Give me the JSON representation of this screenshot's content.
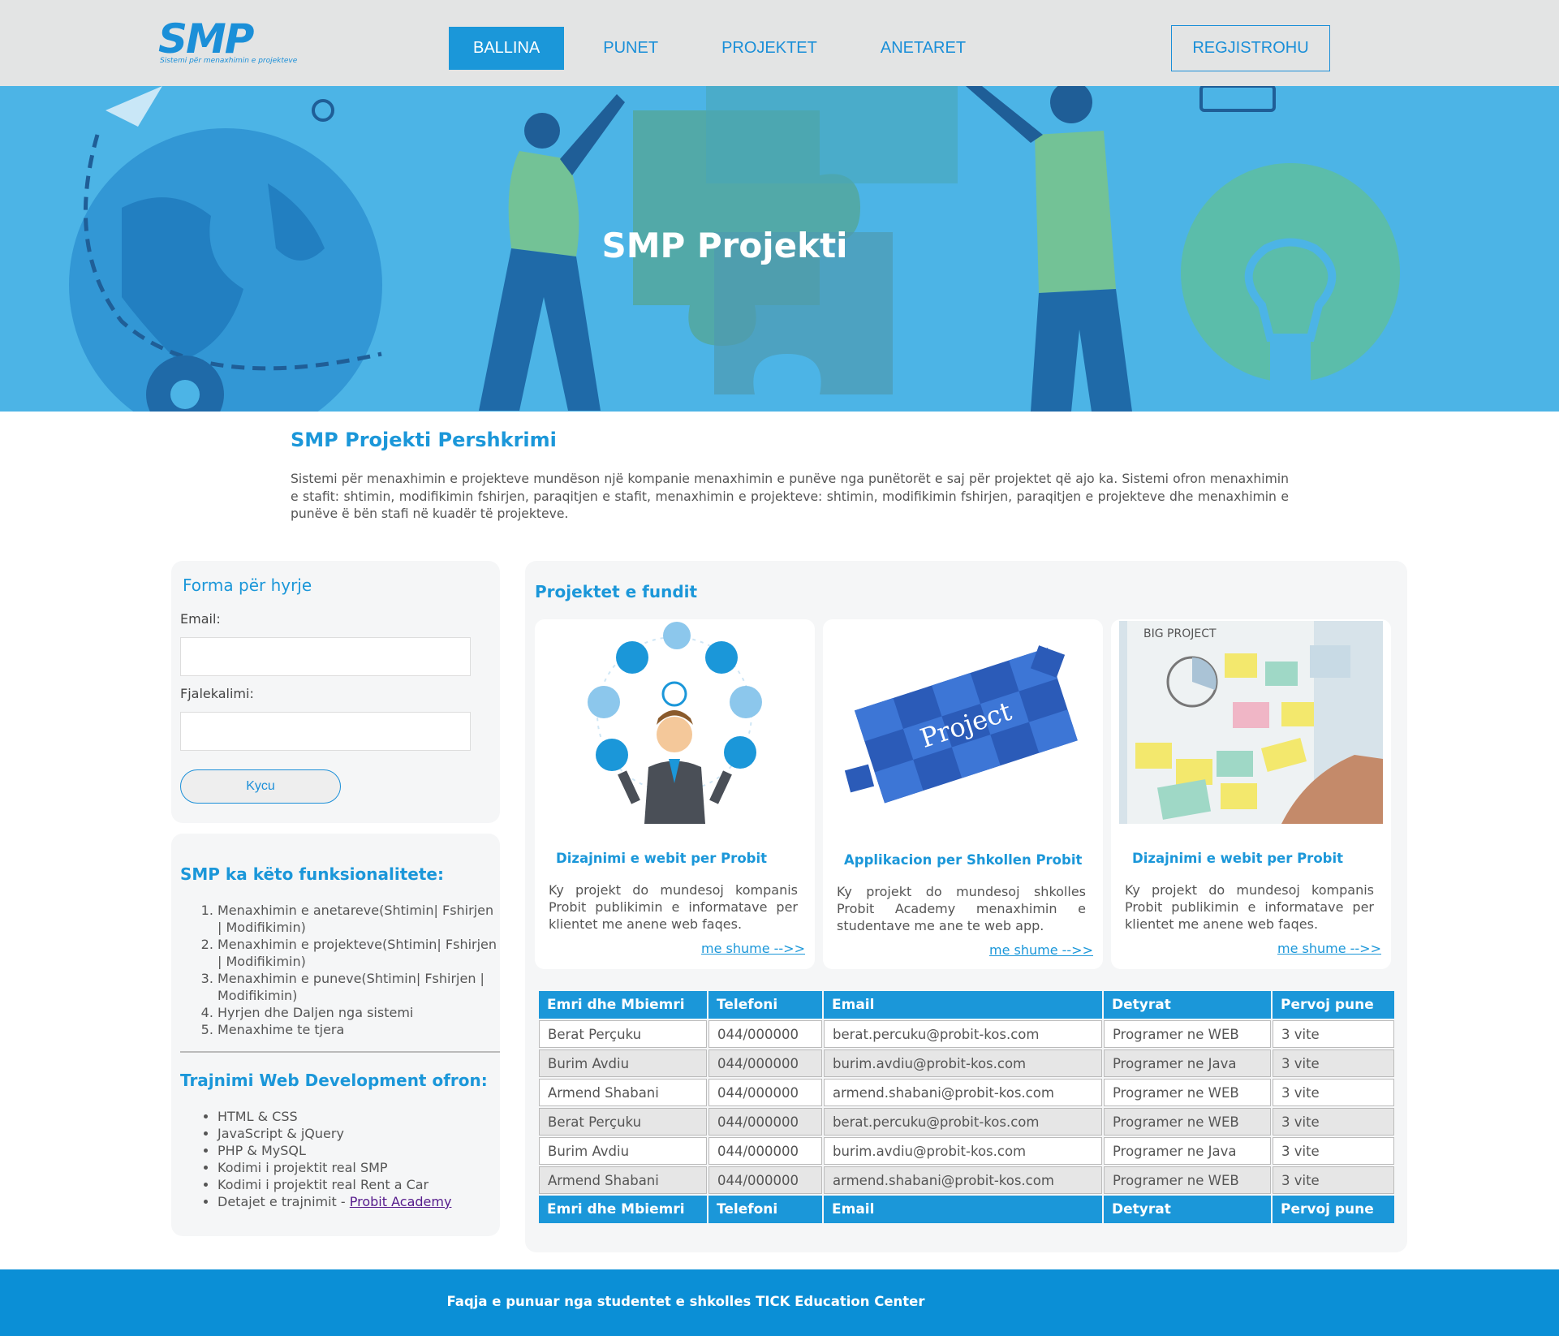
{
  "header": {
    "logo_text": "SMP",
    "logo_subtitle": "Sistemi për menaxhimin e projekteve",
    "nav": [
      {
        "label": "BALLINA",
        "active": true
      },
      {
        "label": "PUNET",
        "active": false
      },
      {
        "label": "PROJEKTET",
        "active": false
      },
      {
        "label": "ANETARET",
        "active": false
      }
    ],
    "register_label": "REGJISTROHU"
  },
  "hero": {
    "title": "SMP Projekti"
  },
  "description": {
    "title": "SMP Projekti Pershkrimi",
    "text": "Sistemi për menaxhimin e projekteve mundëson një kompanie menaxhimin e punëve nga punëtorët e saj për projektet që ajo ka. Sistemi ofron menaxhimin e stafit: shtimin, modifikimin fshirjen, paraqitjen e stafit, menaxhimin e projekteve: shtimin, modifikimin fshirjen, paraqitjen e projekteve dhe menaxhimin e punëve ë bën stafi në kuadër të projekteve."
  },
  "login": {
    "title": "Forma për hyrje",
    "email_label": "Email:",
    "email_value": "",
    "password_label": "Fjalekalimi:",
    "password_value": "",
    "submit_label": "Kycu"
  },
  "features": {
    "title": "SMP ka këto funksionalitete:",
    "items": [
      "Menaxhimin e anetareve(Shtimin| Fshirjen | Modifikimin)",
      "Menaxhimin e projekteve(Shtimin| Fshirjen | Modifikimin)",
      "Menaxhimin e puneve(Shtimin| Fshirjen | Modifikimin)",
      "Hyrjen dhe Daljen nga sistemi",
      "Menaxhime te tjera"
    ]
  },
  "training": {
    "title": "Trajnimi Web Development ofron:",
    "items": [
      "HTML & CSS",
      "JavaScript & jQuery",
      "PHP & MySQL",
      "Kodimi i projektit real SMP",
      "Kodimi i projektit real Rent a Car"
    ],
    "last_item_prefix": "Detajet e trajnimit - ",
    "last_item_link": "Probit Academy"
  },
  "recent": {
    "title": "Projektet e fundit",
    "cards": [
      {
        "title": "Dizajnimi e webit per Probit",
        "text": "Ky projekt do mundesoj kompanis Probit publikimin e informatave per klientet me anene web faqes.",
        "more": "me shume -->>"
      },
      {
        "title": "Applikacion per Shkollen Probit",
        "text": "Ky projekt do mundesoj shkolles Probit Academy menaxhimin e studentave me ane te web app.",
        "more": "me shume -->>",
        "image_word": "Project"
      },
      {
        "title": "Dizajnimi e webit per Probit",
        "text": "Ky projekt do mundesoj kompanis Probit publikimin e informatave per klientet me anene web faqes.",
        "more": "me shume -->>",
        "image_word": "BIG PROJECT"
      }
    ]
  },
  "table": {
    "headers": [
      "Emri dhe Mbiemri",
      "Telefoni",
      "Email",
      "Detyrat",
      "Pervoj pune"
    ],
    "rows": [
      [
        "Berat Perçuku",
        "044/000000",
        "berat.percuku@probit-kos.com",
        "Programer ne WEB",
        "3 vite"
      ],
      [
        "Burim Avdiu",
        "044/000000",
        "burim.avdiu@probit-kos.com",
        "Programer ne Java",
        "3 vite"
      ],
      [
        "Armend Shabani",
        "044/000000",
        "armend.shabani@probit-kos.com",
        "Programer ne WEB",
        "3 vite"
      ],
      [
        "Berat Perçuku",
        "044/000000",
        "berat.percuku@probit-kos.com",
        "Programer ne WEB",
        "3 vite"
      ],
      [
        "Burim Avdiu",
        "044/000000",
        "burim.avdiu@probit-kos.com",
        "Programer ne Java",
        "3 vite"
      ],
      [
        "Armend Shabani",
        "044/000000",
        "armend.shabani@probit-kos.com",
        "Programer ne WEB",
        "3 vite"
      ]
    ]
  },
  "footer": {
    "text": "Faqja e punuar nga studentet e shkolles TICK Education Center"
  },
  "colors": {
    "accent": "#1b97d9",
    "header_bg": "#e3e4e4",
    "hero_bg": "#4cb4e6",
    "footer_bg": "#0b8fd6"
  }
}
